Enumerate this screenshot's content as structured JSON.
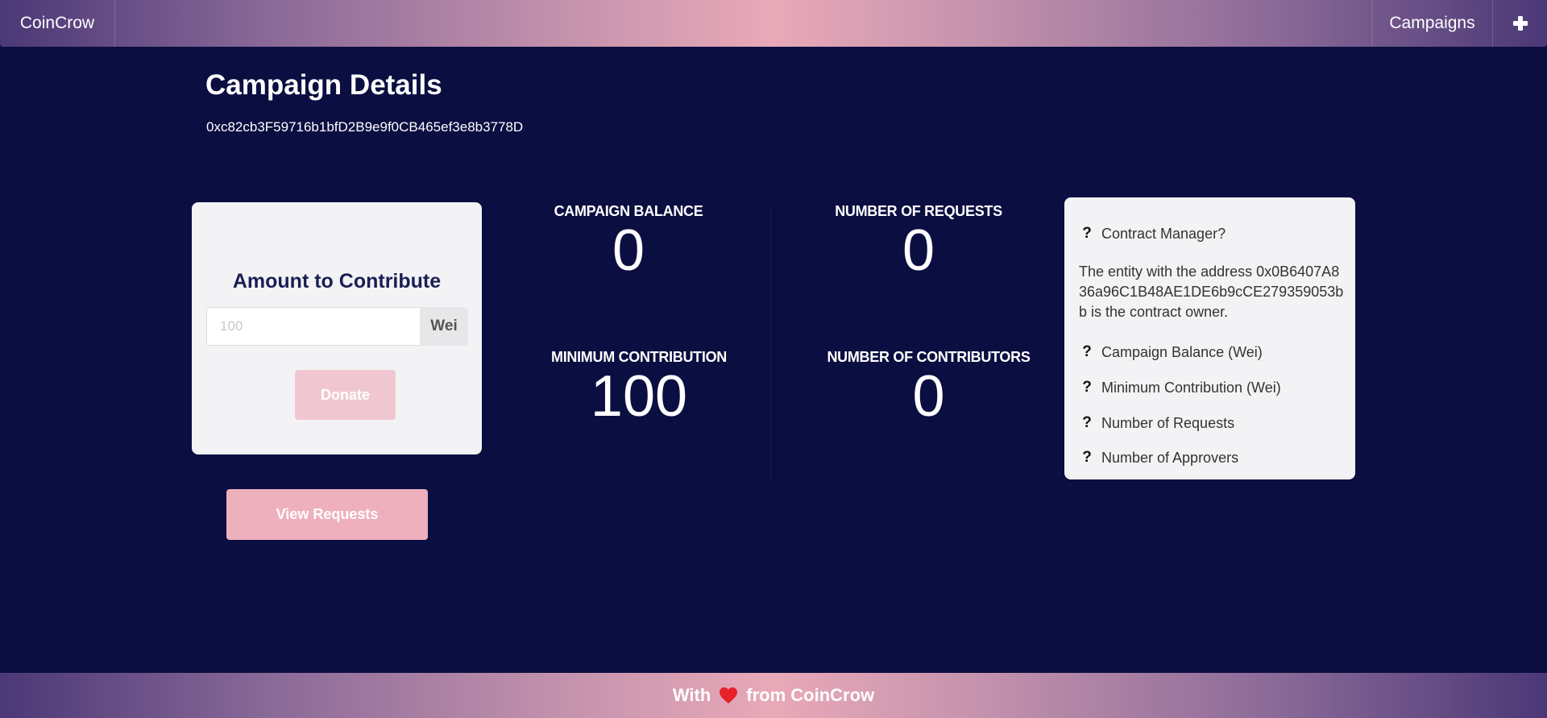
{
  "nav": {
    "brand": "CoinCrow",
    "campaigns": "Campaigns",
    "add_icon": "plus-icon"
  },
  "header": {
    "title": "Campaign Details",
    "address": "0xc82cb3F59716b1bfD2B9e9f0CB465ef3e8b3778D"
  },
  "contribute": {
    "label": "Amount to Contribute",
    "input_value": "",
    "input_placeholder": "100",
    "unit": "Wei",
    "donate_label": "Donate",
    "view_requests_label": "View Requests"
  },
  "stats": {
    "balance": {
      "label": "CAMPAIGN BALANCE",
      "value": "0"
    },
    "requests": {
      "label": "NUMBER OF REQUESTS",
      "value": "0"
    },
    "min_contribution": {
      "label": "MINIMUM CONTRIBUTION",
      "value": "100"
    },
    "contributors": {
      "label": "NUMBER OF CONTRIBUTORS",
      "value": "0"
    }
  },
  "info": {
    "items": [
      {
        "label": "Contract Manager?",
        "icon": "question-icon"
      },
      {
        "label": "Campaign Balance (Wei)",
        "icon": "question-icon"
      },
      {
        "label": "Minimum Contribution (Wei)",
        "icon": "question-icon"
      },
      {
        "label": "Number of Requests",
        "icon": "question-icon"
      },
      {
        "label": "Number of Approvers",
        "icon": "question-icon"
      }
    ],
    "manager_text": "The entity with the address 0x0B6407A836a96C1B48AE1DE6b9cCE279359053bb is the contract owner."
  },
  "footer": {
    "prefix": "With",
    "suffix": "from CoinCrow",
    "icon": "heart-icon"
  },
  "colors": {
    "background": "#0b0e40",
    "accent_pink": "#efb0be",
    "card_bg": "#f3f3f5"
  }
}
